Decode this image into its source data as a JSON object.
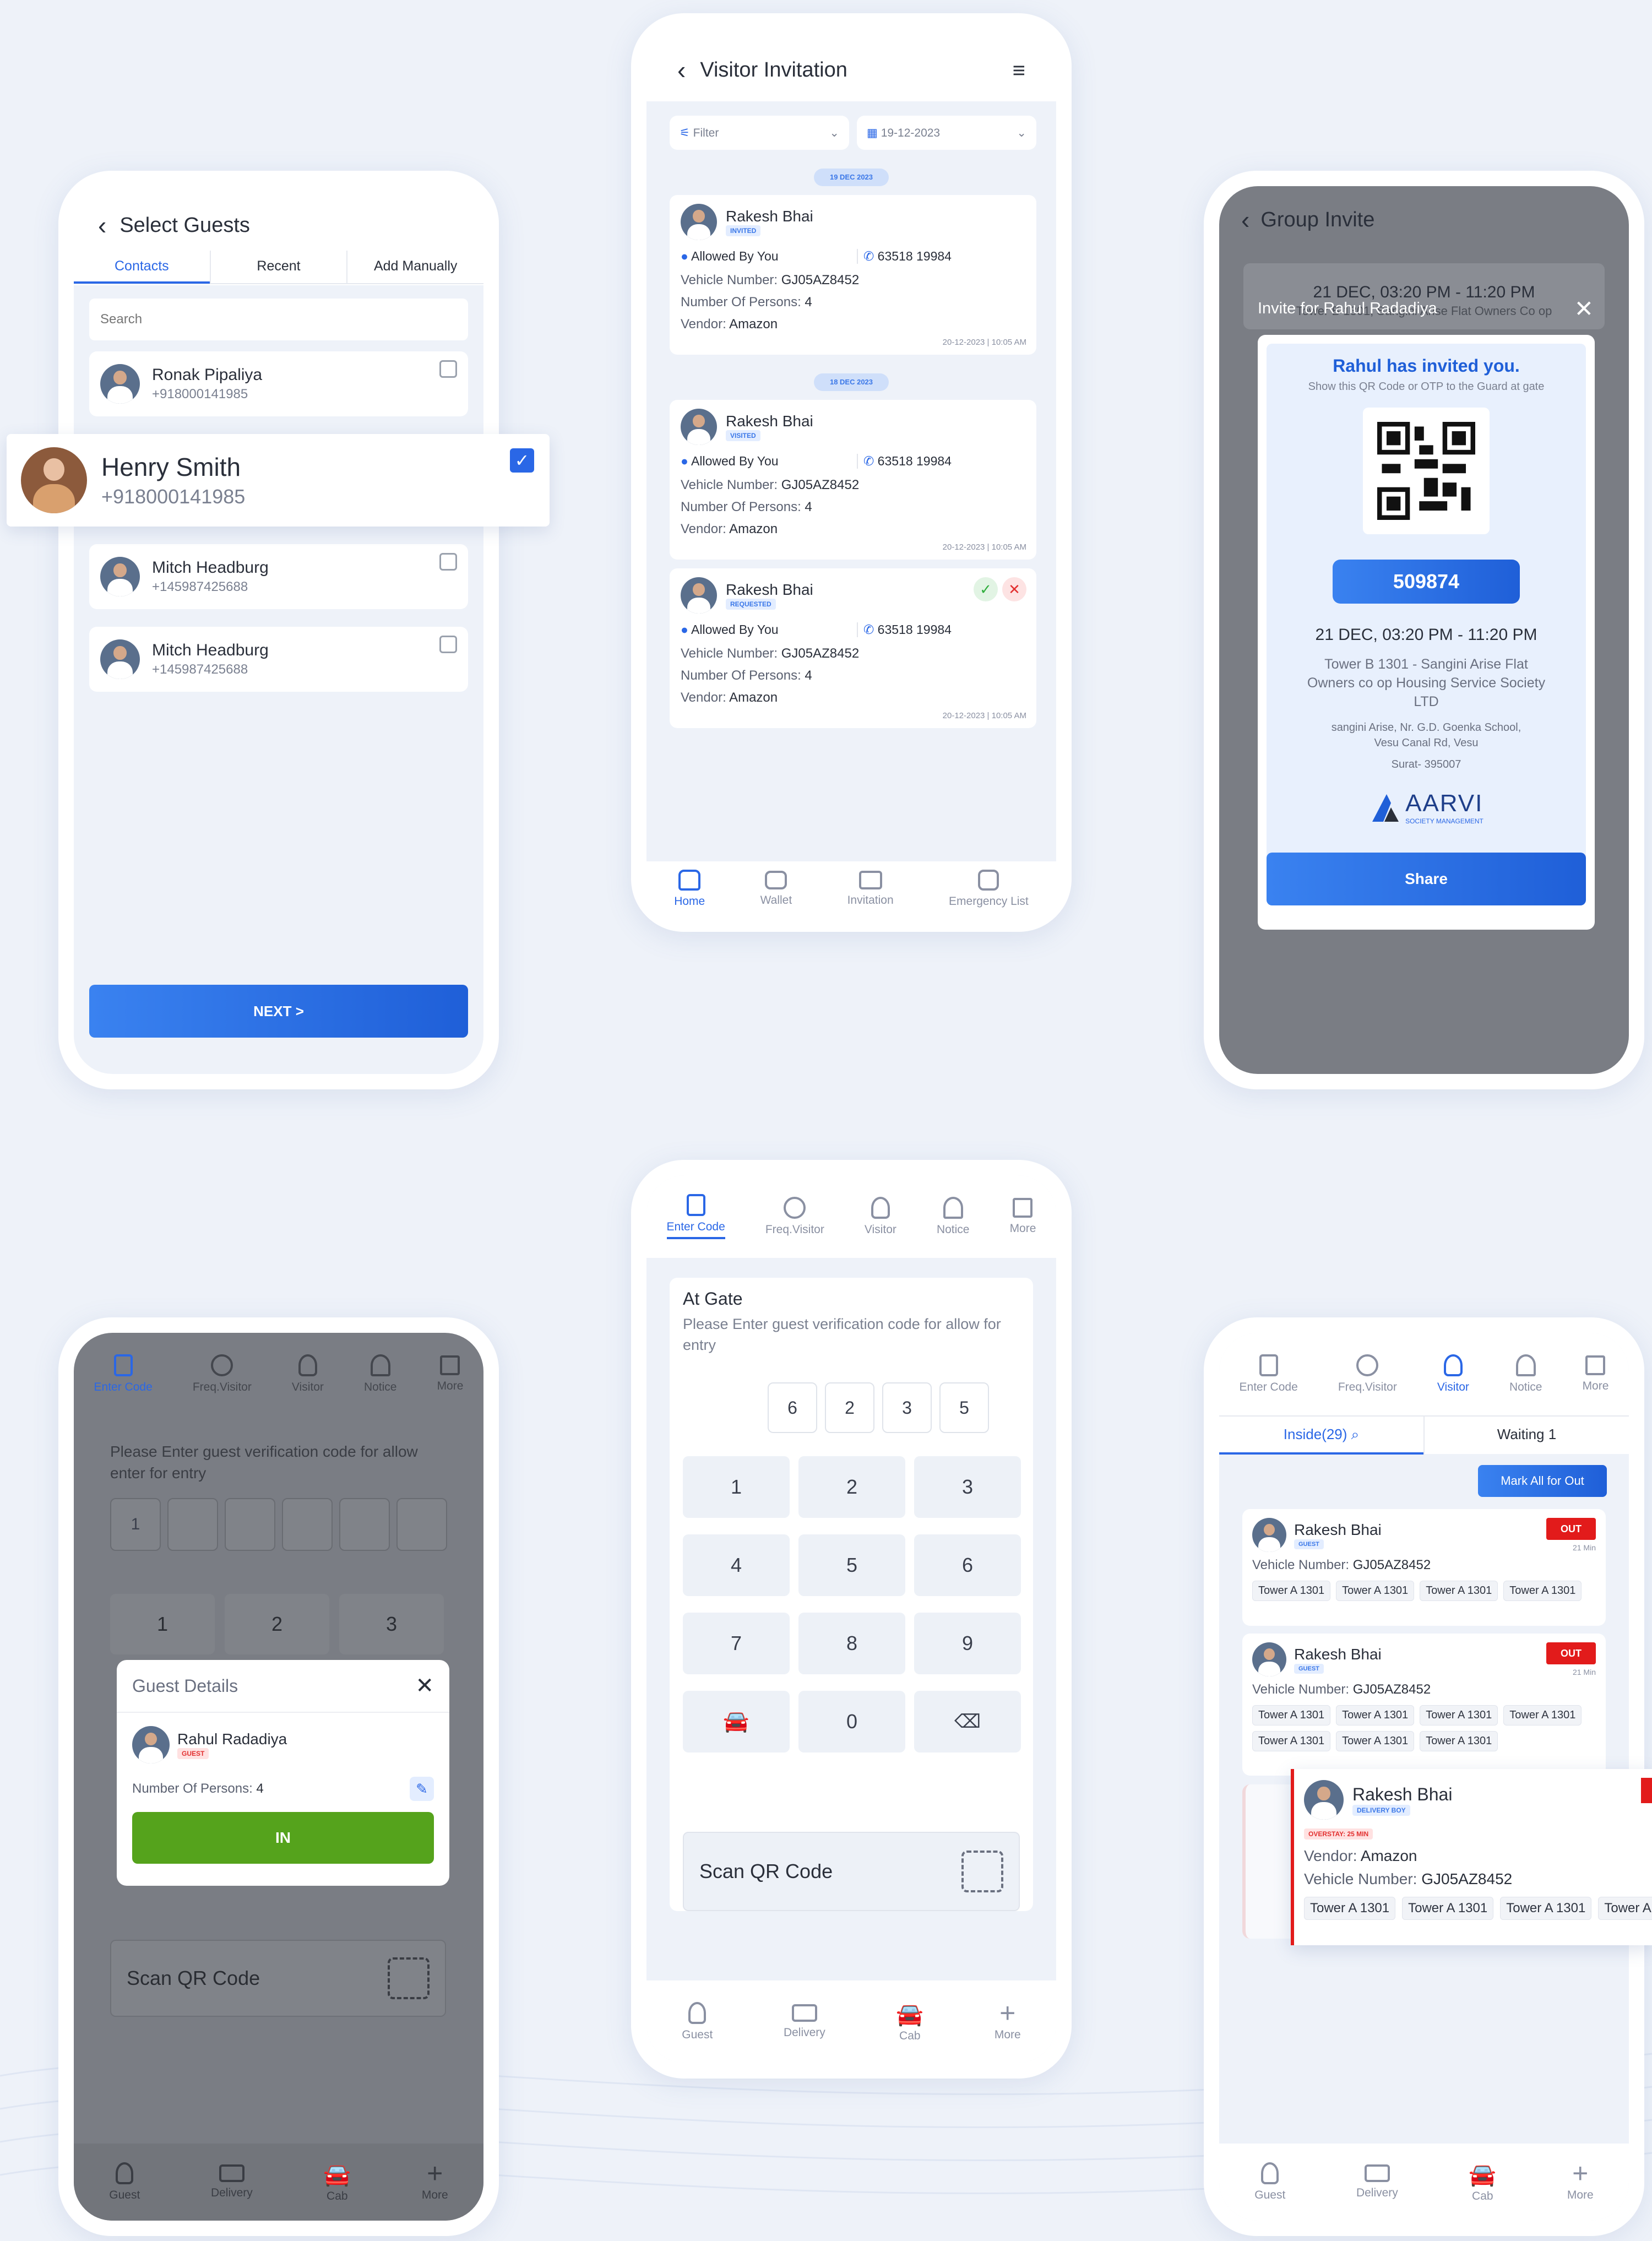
{
  "select_guests": {
    "title": "Select Guests",
    "tabs": [
      "Contacts",
      "Recent",
      "Add Manually"
    ],
    "search_placeholder": "Search",
    "contacts": [
      {
        "name": "Ronak Pipaliya",
        "phone": "+918000141985"
      },
      {
        "name": "Henry Smith",
        "phone": "+918000141985"
      },
      {
        "name": "Mitch Headburg",
        "phone": "+145987425688"
      },
      {
        "name": "Mitch Headburg",
        "phone": "+145987425688"
      }
    ],
    "next": "NEXT >"
  },
  "visitor_invitation": {
    "title": "Visitor Invitation",
    "filter": "Filter",
    "date": "19-12-2023",
    "dates": [
      "19 DEC 2023",
      "18 DEC 2023"
    ],
    "cards": [
      {
        "name": "Rakesh Bhai",
        "status": "INVITED",
        "allowed": "Allowed By You",
        "phone": "63518 19984",
        "vehicle_label": "Vehicle Number:",
        "vehicle": "GJ05AZ8452",
        "persons_label": "Number Of Persons:",
        "persons": "4",
        "vendor_label": "Vendor:",
        "vendor": "Amazon",
        "time": "20-12-2023 | 10:05 AM"
      },
      {
        "name": "Rakesh Bhai",
        "status": "VISITED",
        "allowed": "Allowed By You",
        "phone": "63518 19984",
        "vehicle_label": "Vehicle Number:",
        "vehicle": "GJ05AZ8452",
        "persons_label": "Number Of Persons:",
        "persons": "4",
        "vendor_label": "Vendor:",
        "vendor": "Amazon",
        "time": "20-12-2023 | 10:05 AM"
      },
      {
        "name": "Rakesh Bhai",
        "status": "REQUESTED",
        "allowed": "Allowed By You",
        "phone": "63518 19984",
        "vehicle_label": "Vehicle Number:",
        "vehicle": "GJ05AZ8452",
        "persons_label": "Number Of Persons:",
        "persons": "4",
        "vendor_label": "Vendor:",
        "vendor": "Amazon",
        "time": "20-12-2023 | 10:05 AM"
      }
    ],
    "nav": [
      "Home",
      "Wallet",
      "Invitation",
      "Emergency List"
    ]
  },
  "group_invite": {
    "title": "Group Invite",
    "bg_time": "21 DEC, 03:20 PM - 11:20 PM",
    "bg_addr": "Tower B 1301, Sangini Arise Flat Owners Co op",
    "modal_title": "Invite for Rahul Radadiya",
    "invited": "Rahul has invited you.",
    "sub": "Show this QR Code or OTP to the Guard at gate",
    "otp": "509874",
    "time": "21 DEC, 03:20 PM - 11:20 PM",
    "address": "Tower B 1301 - Sangini Arise Flat Owners co op Housing Service Society LTD",
    "addr2": "sangini Arise, Nr. G.D. Goenka School, Vesu Canal Rd, Vesu",
    "city": "Surat- 395007",
    "brand": "AARVI",
    "brand_sub": "SOCIETY MANAGEMENT",
    "share": "Share"
  },
  "guard_tabs": [
    "Enter Code",
    "Freq.Visitor",
    "Visitor",
    "Notice",
    "More"
  ],
  "at_gate": {
    "title": "At Gate",
    "desc": "Please Enter guest verification code for allow for entry",
    "otp": [
      "6",
      "2",
      "3",
      "5"
    ],
    "keys": [
      "1",
      "2",
      "3",
      "4",
      "5",
      "6",
      "7",
      "8",
      "9",
      "",
      "0",
      ""
    ],
    "scan": "Scan QR Code",
    "nav": [
      "Guest",
      "Delivery",
      "Cab",
      "More"
    ]
  },
  "guest_details": {
    "desc": "Please Enter guest verification code for allow enter for entry",
    "first_digit": "1",
    "keys": [
      "1",
      "2",
      "3"
    ],
    "modal_title": "Guest Details",
    "name": "Rahul Radadiya",
    "tag": "GUEST",
    "persons_label": "Number Of Persons:",
    "persons": "4",
    "in": "IN",
    "scan": "Scan QR Code",
    "nav": [
      "Guest",
      "Delivery",
      "Cab",
      "More"
    ]
  },
  "visitor_list": {
    "tab_inside": "Inside(29)",
    "tab_waiting": "Waiting 1",
    "mark_all": "Mark All for Out",
    "cards": [
      {
        "name": "Rakesh Bhai",
        "tag": "GUEST",
        "out": "OUT",
        "mins": "21 Min",
        "vehicle_label": "Vehicle Number:",
        "vehicle": "GJ05AZ8452",
        "chips": [
          "Tower A 1301",
          "Tower A 1301",
          "Tower A 1301",
          "Tower A 1301"
        ]
      },
      {
        "name": "Rakesh Bhai",
        "tag": "GUEST",
        "out": "OUT",
        "mins": "21 Min",
        "vehicle_label": "Vehicle Number:",
        "vehicle": "GJ05AZ8452",
        "chips": [
          "Tower A 1301",
          "Tower A 1301",
          "Tower A 1301",
          "Tower A 1301",
          "Tower A 1301",
          "Tower A 1301",
          "Tower A 1301"
        ]
      }
    ],
    "popout": {
      "name": "Rakesh Bhai",
      "tag": "DELIVERY BOY",
      "overstay": "OVERSTAY: 25 MIN",
      "vendor_label": "Vendor:",
      "vendor": "Amazon",
      "vehicle_label": "Vehicle Number:",
      "vehicle": "GJ05AZ8452",
      "chips": [
        "Tower A 1301",
        "Tower A 1301",
        "Tower A 1301",
        "Tower A"
      ]
    },
    "nav": [
      "Guest",
      "Delivery",
      "Cab",
      "More"
    ]
  }
}
